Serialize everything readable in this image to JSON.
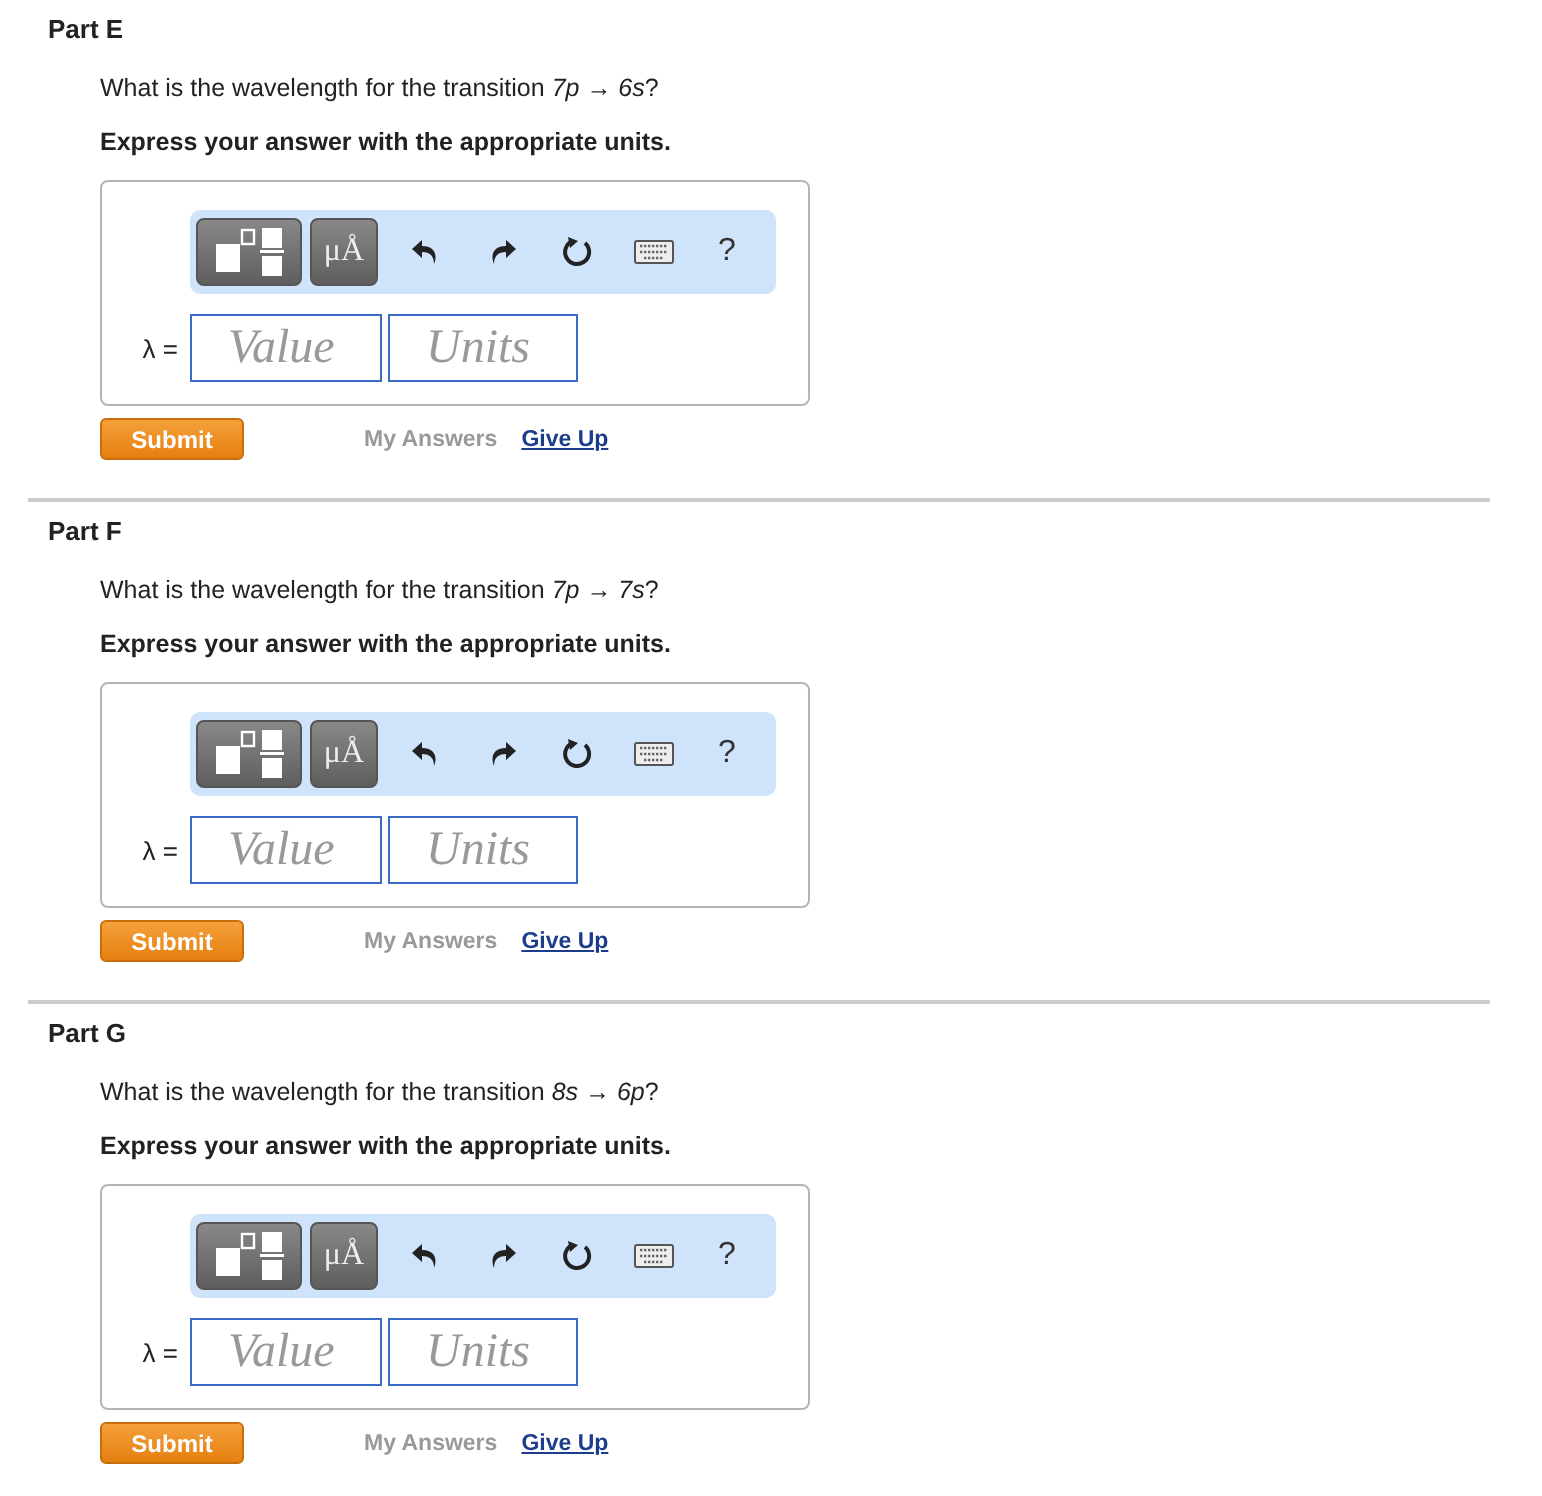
{
  "parts": [
    {
      "title": "Part E",
      "question": "What is the wavelength for the transition *7p → 6s*?",
      "instruction": "Express your answer with the appropriate units.",
      "toolbar": {
        "units_button": "μÅ",
        "help": "?"
      },
      "variable": "λ =",
      "value_placeholder": "Value",
      "units_placeholder": "Units",
      "submit": "Submit",
      "my_answers": {
        "label": "My Answers",
        "disabled": true
      },
      "give_up": "Give Up"
    },
    {
      "title": "Part F",
      "question": "What is the wavelength for the transition *7p → 7s*?",
      "instruction": "Express your answer with the appropriate units.",
      "toolbar": {
        "units_button": "μÅ",
        "help": "?"
      },
      "variable": "λ =",
      "value_placeholder": "Value",
      "units_placeholder": "Units",
      "submit": "Submit",
      "my_answers": {
        "label": "My Answers",
        "disabled": true
      },
      "give_up": "Give Up"
    },
    {
      "title": "Part G",
      "question": "What is the wavelength for the transition *8s → 6p*?",
      "instruction": "Express your answer with the appropriate units.",
      "toolbar": {
        "units_button": "μÅ",
        "help": "?"
      },
      "variable": "λ =",
      "value_placeholder": "Value",
      "units_placeholder": "Units",
      "submit": "Submit",
      "my_answers": {
        "label": "My Answers",
        "disabled": true
      },
      "give_up": "Give Up"
    }
  ]
}
